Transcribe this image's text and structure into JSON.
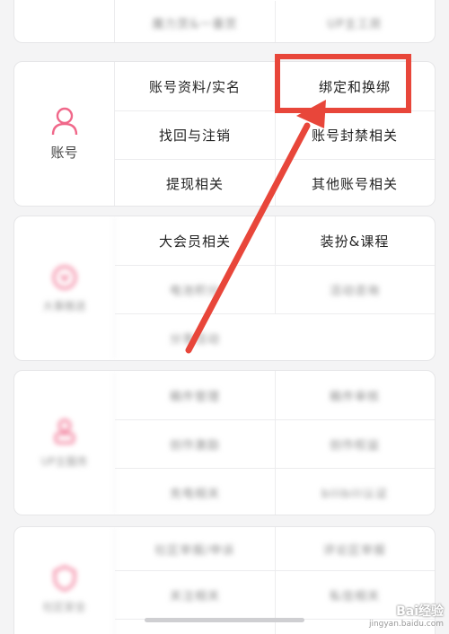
{
  "top_row": {
    "left": "魔力赏&一番赏",
    "right": "UP主工房"
  },
  "account": {
    "category_label": "账号",
    "icon": "user-icon",
    "items": [
      "账号资料/实名",
      "绑定和换绑",
      "找回与注销",
      "账号封禁相关",
      "提现相关",
      "其他账号相关"
    ]
  },
  "vip_section": {
    "row1": {
      "left": "大会员相关",
      "right": "装扮&课程"
    },
    "blurred_items": [
      "电池积分",
      "活动咨询",
      "分享活动"
    ],
    "category_label": "大事推送"
  },
  "up_section": {
    "category_label": "UP主服务",
    "blurred_items": [
      "稿件管理",
      "稿件审核",
      "创作激励",
      "创作权益",
      "充电相关",
      "bilibili认证"
    ]
  },
  "other_section": {
    "category_label": "社区安全",
    "blurred_items": [
      "社区举报/申诉",
      "评论区举报",
      "关注相关",
      "私信相关"
    ]
  },
  "watermark": {
    "brand": "Bai经验",
    "url": "jingyan.baidu.com"
  },
  "colors": {
    "accent": "#e8463a",
    "brand_pink": "#f0688a"
  }
}
